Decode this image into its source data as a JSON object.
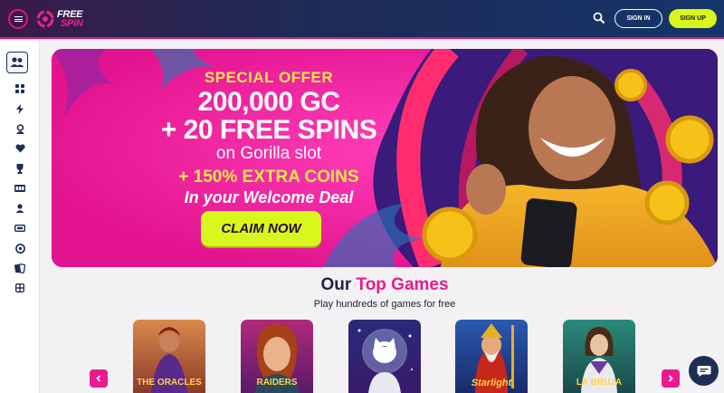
{
  "header": {
    "logo_line1": "FREE",
    "logo_line2": "SPiN",
    "sign_in": "SIGN IN",
    "sign_up": "SIGN UP"
  },
  "sidebar": {
    "items": [
      {
        "icon": "user-group-icon",
        "active": true
      },
      {
        "icon": "grid-icon"
      },
      {
        "icon": "lightning-icon"
      },
      {
        "icon": "spade-person-icon"
      },
      {
        "icon": "heart-icon"
      },
      {
        "icon": "trophy-icon"
      },
      {
        "icon": "slot-machine-icon"
      },
      {
        "icon": "person-icon"
      },
      {
        "icon": "ticket-icon"
      },
      {
        "icon": "roulette-icon"
      },
      {
        "icon": "cards-icon"
      },
      {
        "icon": "table-icon"
      }
    ]
  },
  "hero": {
    "special_offer": "SPECIAL OFFER",
    "line_gc": "200,000 GC",
    "line_spins": "+ 20 FREE SPINS",
    "line_slot": "on Gorilla slot",
    "line_extra": "+ 150% EXTRA COINS",
    "line_deal": "In your Welcome Deal",
    "cta": "CLAIM NOW"
  },
  "top_games": {
    "title_part1": "Our",
    "title_part2": "Top Games",
    "subtitle": "Play hundreds of games for free",
    "games": [
      {
        "label": "THE ORACLES",
        "icon": "oracles-thumbnail"
      },
      {
        "label": "RAIDERS",
        "icon": "raiders-thumbnail"
      },
      {
        "label": "",
        "icon": "space-cat-thumbnail"
      },
      {
        "label": "Starlight",
        "icon": "starlight-thumbnail"
      },
      {
        "label": "LA BRUJA",
        "icon": "witch-thumbnail"
      }
    ]
  },
  "colors": {
    "accent_pink": "#e81a8f",
    "accent_lime": "#d9f71c",
    "navy": "#1f2c55"
  }
}
